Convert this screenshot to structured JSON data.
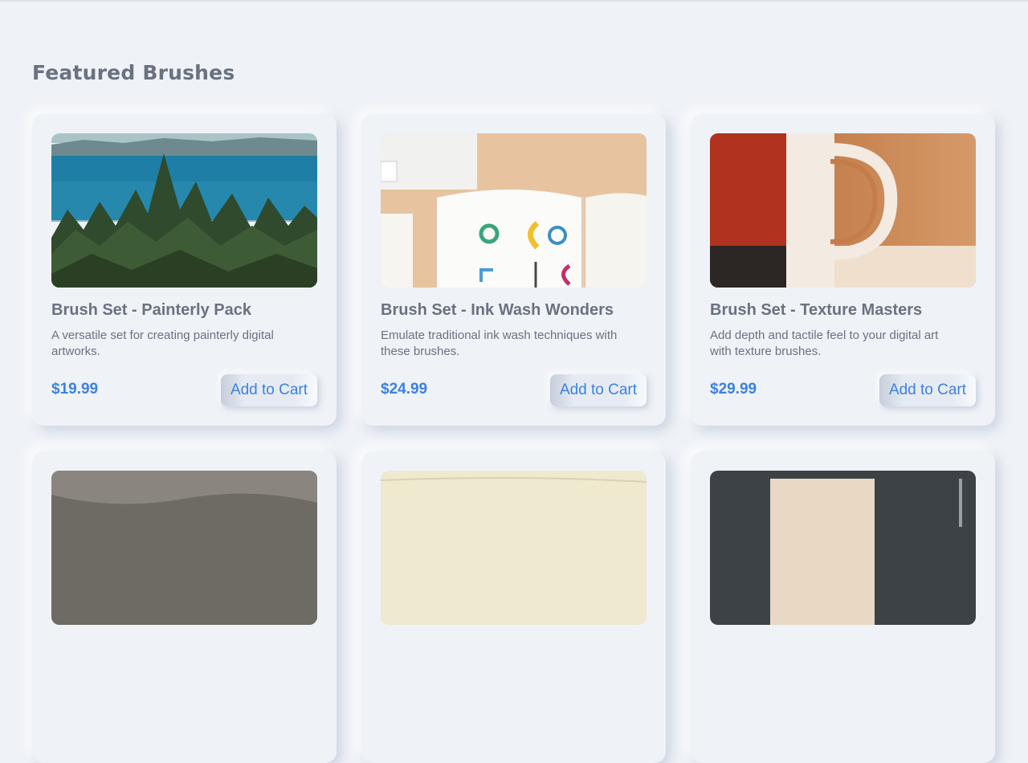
{
  "section": {
    "title": "Featured Brushes"
  },
  "products": [
    {
      "title": "Brush Set - Painterly Pack",
      "description": "A versatile set for creating painterly digital artworks.",
      "price": "$19.99",
      "button": "Add to Cart",
      "image_alt": "forest-and-lake-photo"
    },
    {
      "title": "Brush Set - Ink Wash Wonders",
      "description": "Emulate traditional ink wash techniques with these brushes.",
      "price": "$24.99",
      "button": "Add to Cart",
      "image_alt": "design-notebook-photo"
    },
    {
      "title": "Brush Set - Texture Masters",
      "description": "Add depth and tactile feel to your digital art with texture brushes.",
      "price": "$29.99",
      "button": "Add to Cart",
      "image_alt": "coffee-mug-photo"
    }
  ],
  "colors": {
    "background": "#eff2f7",
    "text": "#6a7280",
    "accent": "#3b82e0"
  }
}
